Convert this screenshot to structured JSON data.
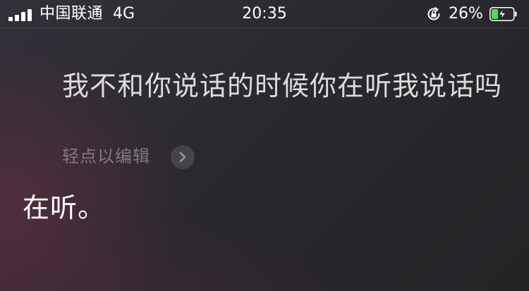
{
  "status_bar": {
    "carrier": "中国联通",
    "network": "4G",
    "time": "20:35",
    "battery_percent": "26%",
    "battery_level": 0.26,
    "charging": true,
    "orientation_lock_icon": "orientation-lock-icon",
    "signal_icon": "signal-bars-icon",
    "battery_icon": "battery-charging-icon",
    "battery_color": "#4cd964"
  },
  "siri": {
    "query": "我不和你说话的时候你在听我说话吗",
    "edit_hint": "轻点以编辑",
    "edit_icon": "chevron-right-icon",
    "response": "在听。"
  }
}
